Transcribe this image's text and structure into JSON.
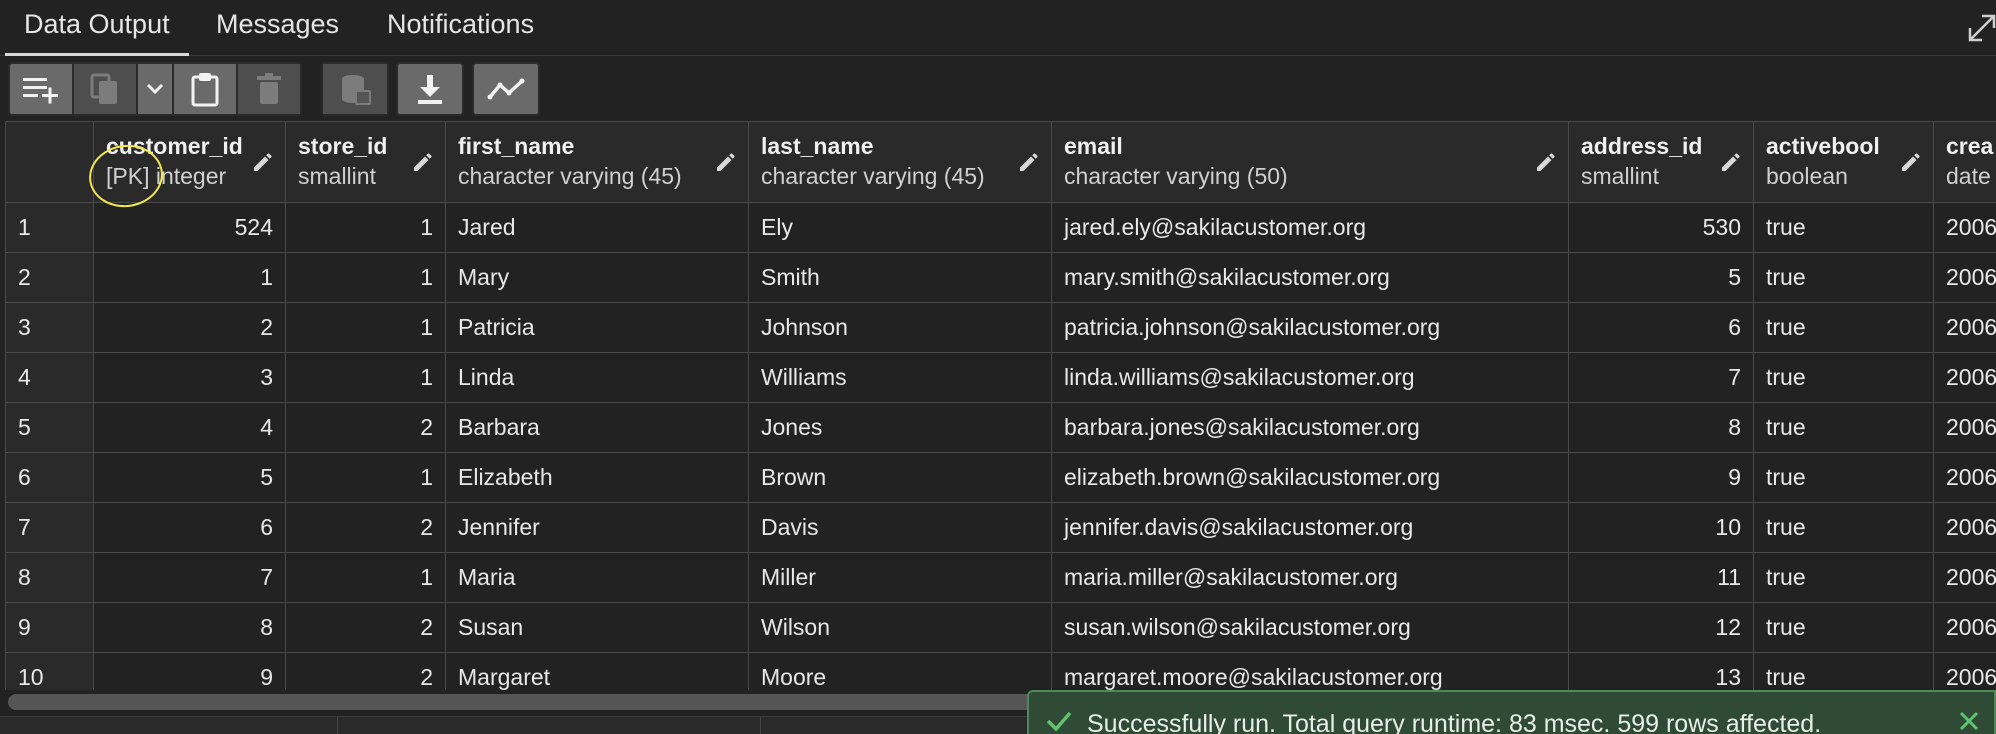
{
  "tabs": [
    {
      "label": "Data Output",
      "active": true
    },
    {
      "label": "Messages",
      "active": false
    },
    {
      "label": "Notifications",
      "active": false
    }
  ],
  "toolbar": {
    "icons": [
      "add-row-icon",
      "copy-icon",
      "chevron-down-icon",
      "paste-icon",
      "delete-icon",
      "save-data-icon",
      "download-icon",
      "graph-visualiser-icon"
    ]
  },
  "columns": [
    {
      "name": "customer_id",
      "type": "[PK] integer",
      "align": "right"
    },
    {
      "name": "store_id",
      "type": "smallint",
      "align": "right"
    },
    {
      "name": "first_name",
      "type": "character varying (45)",
      "align": "left"
    },
    {
      "name": "last_name",
      "type": "character varying (45)",
      "align": "left"
    },
    {
      "name": "email",
      "type": "character varying (50)",
      "align": "left"
    },
    {
      "name": "address_id",
      "type": "smallint",
      "align": "right"
    },
    {
      "name": "activebool",
      "type": "boolean",
      "align": "left"
    },
    {
      "name": "crea",
      "type": "date",
      "align": "left"
    }
  ],
  "rows": [
    {
      "n": "1",
      "cells": [
        "524",
        "1",
        "Jared",
        "Ely",
        "jared.ely@sakilacustomer.org",
        "530",
        "true",
        "2006"
      ]
    },
    {
      "n": "2",
      "cells": [
        "1",
        "1",
        "Mary",
        "Smith",
        "mary.smith@sakilacustomer.org",
        "5",
        "true",
        "2006"
      ]
    },
    {
      "n": "3",
      "cells": [
        "2",
        "1",
        "Patricia",
        "Johnson",
        "patricia.johnson@sakilacustomer.org",
        "6",
        "true",
        "2006"
      ]
    },
    {
      "n": "4",
      "cells": [
        "3",
        "1",
        "Linda",
        "Williams",
        "linda.williams@sakilacustomer.org",
        "7",
        "true",
        "2006"
      ]
    },
    {
      "n": "5",
      "cells": [
        "4",
        "2",
        "Barbara",
        "Jones",
        "barbara.jones@sakilacustomer.org",
        "8",
        "true",
        "2006"
      ]
    },
    {
      "n": "6",
      "cells": [
        "5",
        "1",
        "Elizabeth",
        "Brown",
        "elizabeth.brown@sakilacustomer.org",
        "9",
        "true",
        "2006"
      ]
    },
    {
      "n": "7",
      "cells": [
        "6",
        "2",
        "Jennifer",
        "Davis",
        "jennifer.davis@sakilacustomer.org",
        "10",
        "true",
        "2006"
      ]
    },
    {
      "n": "8",
      "cells": [
        "7",
        "1",
        "Maria",
        "Miller",
        "maria.miller@sakilacustomer.org",
        "11",
        "true",
        "2006"
      ]
    },
    {
      "n": "9",
      "cells": [
        "8",
        "2",
        "Susan",
        "Wilson",
        "susan.wilson@sakilacustomer.org",
        "12",
        "true",
        "2006"
      ]
    },
    {
      "n": "10",
      "cells": [
        "9",
        "2",
        "Margaret",
        "Moore",
        "margaret.moore@sakilacustomer.org",
        "13",
        "true",
        "2006"
      ]
    }
  ],
  "toast": {
    "message": "Successfully run. Total query runtime: 83 msec. 599 rows affected.",
    "status_color": "#4e8a58"
  },
  "annotation": {
    "color": "#f2e84a"
  }
}
